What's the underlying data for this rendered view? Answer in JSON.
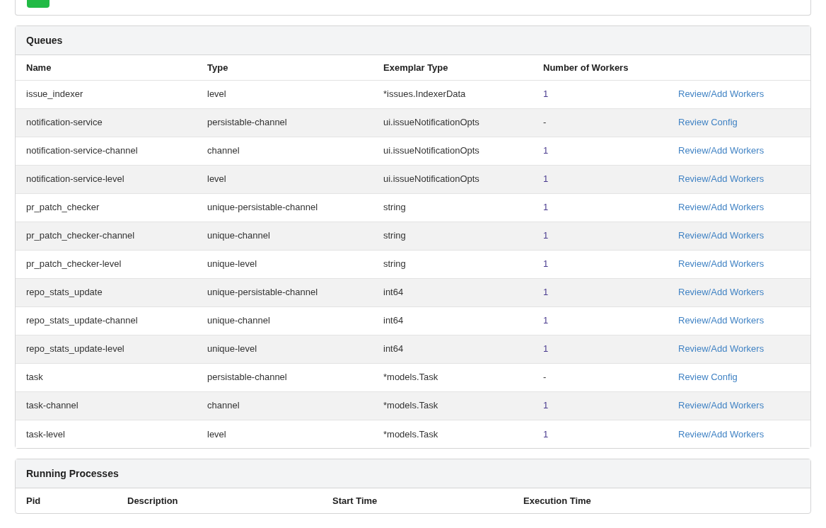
{
  "queues": {
    "title": "Queues",
    "columns": [
      "Name",
      "Type",
      "Exemplar Type",
      "Number of Workers"
    ],
    "rows": [
      {
        "name": "issue_indexer",
        "type": "level",
        "exemplar": "*issues.IndexerData",
        "workers": "1",
        "action": "Review/Add Workers",
        "kind": "workers"
      },
      {
        "name": "notification-service",
        "type": "persistable-channel",
        "exemplar": "ui.issueNotificationOpts",
        "workers": "-",
        "action": "Review Config",
        "kind": "config"
      },
      {
        "name": "notification-service-channel",
        "type": "channel",
        "exemplar": "ui.issueNotificationOpts",
        "workers": "1",
        "action": "Review/Add Workers",
        "kind": "workers"
      },
      {
        "name": "notification-service-level",
        "type": "level",
        "exemplar": "ui.issueNotificationOpts",
        "workers": "1",
        "action": "Review/Add Workers",
        "kind": "workers"
      },
      {
        "name": "pr_patch_checker",
        "type": "unique-persistable-channel",
        "exemplar": "string",
        "workers": "1",
        "action": "Review/Add Workers",
        "kind": "workers"
      },
      {
        "name": "pr_patch_checker-channel",
        "type": "unique-channel",
        "exemplar": "string",
        "workers": "1",
        "action": "Review/Add Workers",
        "kind": "workers"
      },
      {
        "name": "pr_patch_checker-level",
        "type": "unique-level",
        "exemplar": "string",
        "workers": "1",
        "action": "Review/Add Workers",
        "kind": "workers"
      },
      {
        "name": "repo_stats_update",
        "type": "unique-persistable-channel",
        "exemplar": "int64",
        "workers": "1",
        "action": "Review/Add Workers",
        "kind": "workers"
      },
      {
        "name": "repo_stats_update-channel",
        "type": "unique-channel",
        "exemplar": "int64",
        "workers": "1",
        "action": "Review/Add Workers",
        "kind": "workers"
      },
      {
        "name": "repo_stats_update-level",
        "type": "unique-level",
        "exemplar": "int64",
        "workers": "1",
        "action": "Review/Add Workers",
        "kind": "workers"
      },
      {
        "name": "task",
        "type": "persistable-channel",
        "exemplar": "*models.Task",
        "workers": "-",
        "action": "Review Config",
        "kind": "config"
      },
      {
        "name": "task-channel",
        "type": "channel",
        "exemplar": "*models.Task",
        "workers": "1",
        "action": "Review/Add Workers",
        "kind": "workers"
      },
      {
        "name": "task-level",
        "type": "level",
        "exemplar": "*models.Task",
        "workers": "1",
        "action": "Review/Add Workers",
        "kind": "workers"
      }
    ]
  },
  "processes": {
    "title": "Running Processes",
    "columns": [
      "Pid",
      "Description",
      "Start Time",
      "Execution Time"
    ]
  }
}
